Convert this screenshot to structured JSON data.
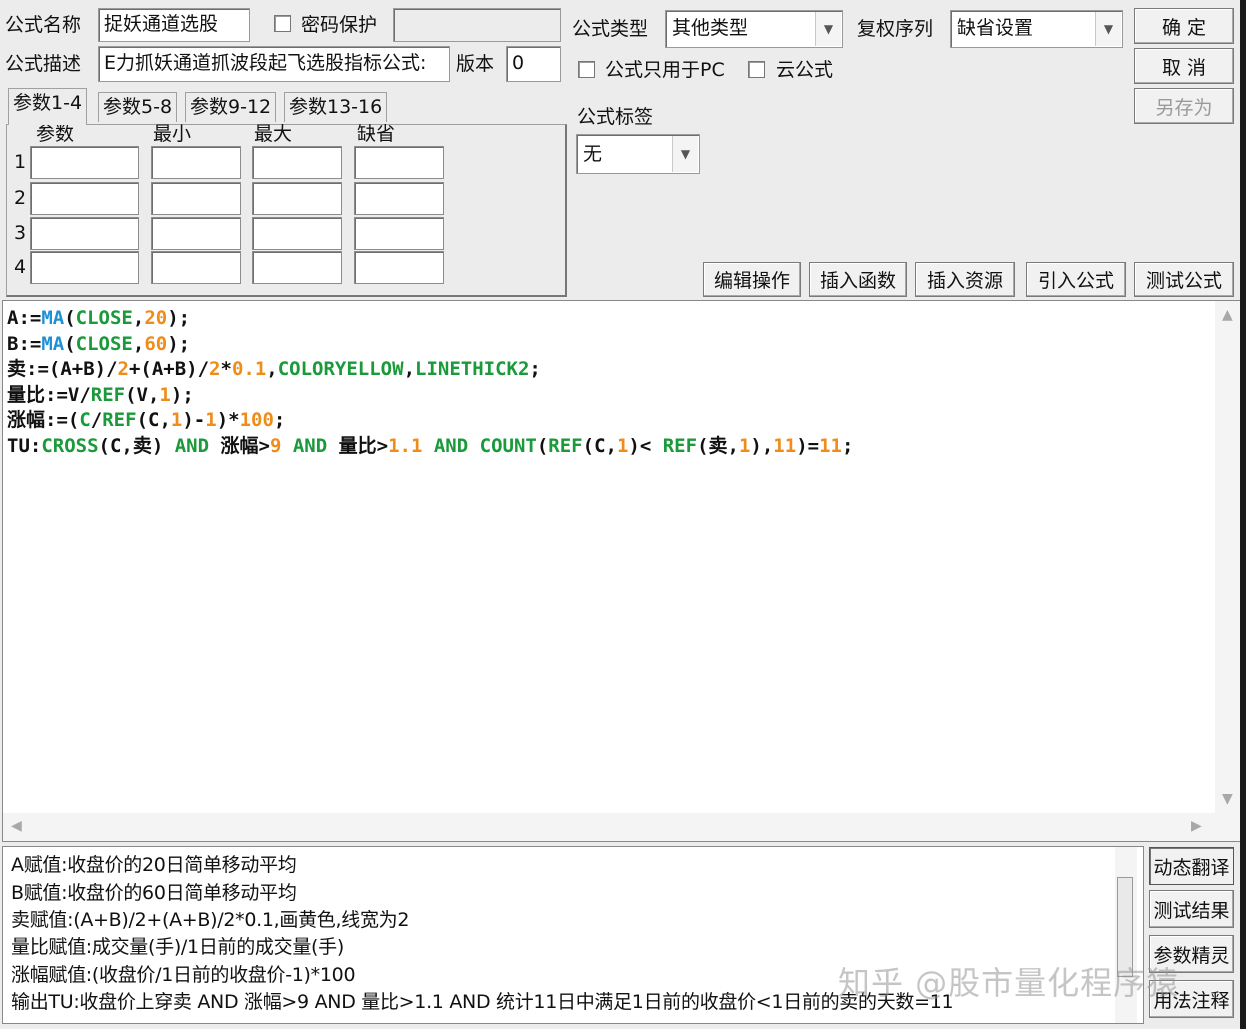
{
  "colors": {
    "function": "#1e8fd8",
    "green": "#1a9a3a",
    "number": "#f08c1a",
    "window_bg": "#ececec",
    "watermark": "#969696"
  },
  "header": {
    "name_label": "公式名称",
    "name_value": "捉妖通道选股",
    "password_label": "密码保护",
    "password_value": "",
    "desc_label": "公式描述",
    "desc_value": "E力抓妖通道抓波段起飞选股指标公式:",
    "version_label": "版本",
    "version_value": "0",
    "type_label": "公式类型",
    "type_value": "其他类型",
    "fq_label": "复权序列",
    "fq_value": "缺省设置",
    "pc_only_label": "公式只用于PC",
    "cloud_label": "云公式",
    "tag_label": "公式标签",
    "tag_value": "无"
  },
  "buttons": {
    "ok": "确  定",
    "cancel": "取  消",
    "save_as": "另存为",
    "edit_ops": "编辑操作",
    "insert_func": "插入函数",
    "insert_res": "插入资源",
    "import_formula": "引入公式",
    "test_formula": "测试公式"
  },
  "params": {
    "tabs": [
      "参数1-4",
      "参数5-8",
      "参数9-12",
      "参数13-16"
    ],
    "columns": [
      "参数",
      "最小",
      "最大",
      "缺省"
    ],
    "rows": [
      "1",
      "2",
      "3",
      "4"
    ]
  },
  "code_lines": [
    [
      [
        "A:=",
        ""
      ],
      [
        "MA",
        "f"
      ],
      [
        "(",
        ""
      ],
      [
        "CLOSE",
        "g"
      ],
      [
        ",",
        ""
      ],
      [
        "20",
        "n"
      ],
      [
        ");",
        ""
      ]
    ],
    [
      [
        "B:=",
        ""
      ],
      [
        "MA",
        "f"
      ],
      [
        "(",
        ""
      ],
      [
        "CLOSE",
        "g"
      ],
      [
        ",",
        ""
      ],
      [
        "60",
        "n"
      ],
      [
        ");",
        ""
      ]
    ],
    [
      [
        "卖:=(A+B)/",
        ""
      ],
      [
        "2",
        "n"
      ],
      [
        "+(A+B)/",
        ""
      ],
      [
        "2",
        "n"
      ],
      [
        "*",
        ""
      ],
      [
        "0.1",
        "n"
      ],
      [
        ",",
        ""
      ],
      [
        "COLORYELLOW",
        "g"
      ],
      [
        ",",
        ""
      ],
      [
        "LINETHICK2",
        "g"
      ],
      [
        ";",
        ""
      ]
    ],
    [
      [
        "量比:=V/",
        ""
      ],
      [
        "REF",
        "g"
      ],
      [
        "(V,",
        ""
      ],
      [
        "1",
        "n"
      ],
      [
        ");",
        ""
      ]
    ],
    [
      [
        "涨幅:=(",
        ""
      ],
      [
        "C",
        "g"
      ],
      [
        "/",
        ""
      ],
      [
        "REF",
        "g"
      ],
      [
        "(C,",
        ""
      ],
      [
        "1",
        "n"
      ],
      [
        ")-",
        ""
      ],
      [
        "1",
        "n"
      ],
      [
        ")*",
        ""
      ],
      [
        "100",
        "n"
      ],
      [
        ";",
        ""
      ]
    ],
    [
      [
        "TU:",
        ""
      ],
      [
        "CROSS",
        "g"
      ],
      [
        "(C,卖) ",
        ""
      ],
      [
        "AND",
        "g"
      ],
      [
        " 涨幅>",
        ""
      ],
      [
        "9",
        "n"
      ],
      [
        " ",
        ""
      ],
      [
        "AND",
        "g"
      ],
      [
        " 量比>",
        ""
      ],
      [
        "1.1",
        "n"
      ],
      [
        " ",
        ""
      ],
      [
        "AND",
        "g"
      ],
      [
        " ",
        ""
      ],
      [
        "COUNT",
        "g"
      ],
      [
        "(",
        ""
      ],
      [
        "REF",
        "g"
      ],
      [
        "(C,",
        ""
      ],
      [
        "1",
        "n"
      ],
      [
        ")< ",
        ""
      ],
      [
        "REF",
        "g"
      ],
      [
        "(卖,",
        ""
      ],
      [
        "1",
        "n"
      ],
      [
        "),",
        ""
      ],
      [
        "11",
        "n"
      ],
      [
        ")=",
        ""
      ],
      [
        "11",
        "n"
      ],
      [
        ";",
        ""
      ]
    ]
  ],
  "explanation": [
    "A赋值:收盘价的20日简单移动平均",
    "B赋值:收盘价的60日简单移动平均",
    "卖赋值:(A+B)/2+(A+B)/2*0.1,画黄色,线宽为2",
    "量比赋值:成交量(手)/1日前的成交量(手)",
    "涨幅赋值:(收盘价/1日前的收盘价-1)*100",
    "输出TU:收盘价上穿卖 AND 涨幅>9 AND 量比>1.1 AND 统计11日中满足1日前的收盘价<1日前的卖的天数=11"
  ],
  "side_buttons": [
    "动态翻译",
    "测试结果",
    "参数精灵",
    "用法注释"
  ],
  "watermark": "知乎 @股市量化程序猿"
}
